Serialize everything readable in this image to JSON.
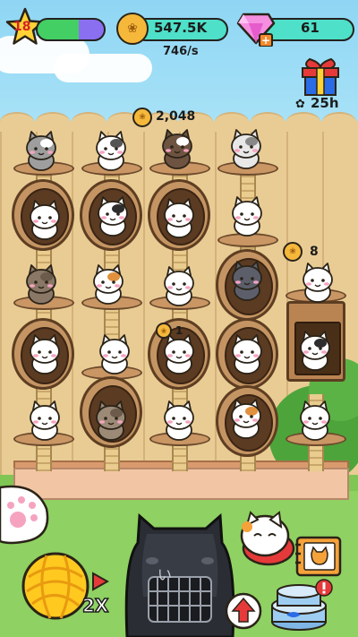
{
  "hud": {
    "level": "18",
    "coins": "547.5K",
    "coin_rate": "746/s",
    "gems": "61"
  },
  "gift": {
    "timer": "25h"
  },
  "rewards": {
    "top_reward": "2,048",
    "right_reward": "8",
    "mid_reward": "1"
  },
  "multiplier": "2X",
  "crate_label": "い",
  "colors": {
    "sky": "#8fd6f4",
    "fence": "#e6c88f",
    "grass": "#8fd162",
    "coin": "#f5b83a",
    "gem_bar": "#4ee0c8",
    "xp_bar": "#8a6ff0"
  },
  "icons": [
    "star-icon",
    "paw-coin-icon",
    "gem-icon",
    "gift-icon",
    "paw-icon",
    "paw-button-icon",
    "yarn-ball-icon",
    "cat-crate-icon",
    "cat-shop-icon",
    "photo-book-icon",
    "tuna-can-icon",
    "alert-icon",
    "upgrade-arrow-icon"
  ]
}
